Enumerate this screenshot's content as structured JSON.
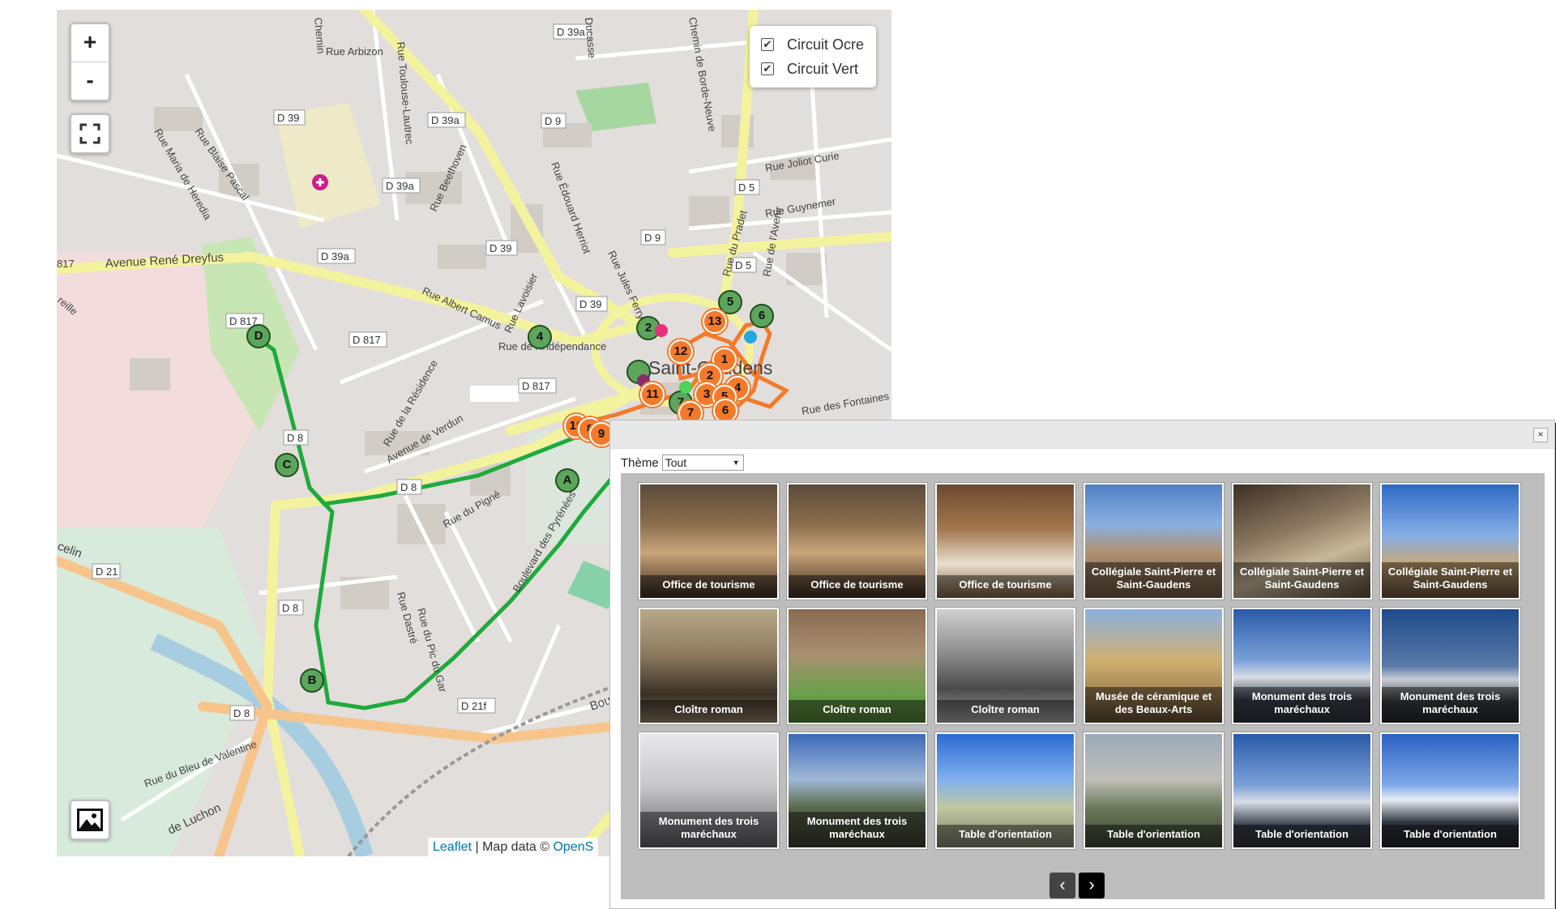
{
  "map": {
    "zoom_in": "+",
    "zoom_out": "-",
    "layers": [
      {
        "label": "Circuit Ocre",
        "checked": true
      },
      {
        "label": "Circuit Vert",
        "checked": true
      }
    ],
    "attribution": {
      "leaflet": "Leaflet",
      "sep": " | Map data © ",
      "osm": "OpenS"
    },
    "city_label": "Saint-Gaudens",
    "road_labels": [
      "D 39a",
      "D 39",
      "D 39a",
      "D 39a",
      "D 39a",
      "D 9",
      "D 9",
      "D 5",
      "D 5",
      "D 39",
      "D 39",
      "D 817",
      "D 817",
      "D 817",
      "D 8",
      "D 8",
      "D 8",
      "D 8",
      "D 21",
      "D 21f",
      "Avenue René Dreyfus",
      "Rue Arbizon",
      "Rue Toulouse-Lautrec",
      "Rue Blaise Pascal",
      "Rue Maria de Heredia",
      "Rue Beethoven",
      "Rue Édouard Herriot",
      "Rue Jules Ferry",
      "Rue Albert Camus",
      "Rue Lavoisier",
      "Rue de l'Indépendance",
      "Rue de la Résidence",
      "Avenue de Verdun",
      "Rue du Pigné",
      "Boulevard des Pyrénées",
      "Rue Joliot Curie",
      "Rue Guynemer",
      "Rue du Pradet",
      "Rue de l'Avenir",
      "Rue des Fontaines",
      "Rue Dastré",
      "Rue du Pic du Gar",
      "Boulevard",
      "de Luchon",
      "Rue du Bleu de Valentine",
      "Chemin de Borde-Neuve",
      "Ducasse",
      "Chemin",
      "celin",
      "817",
      "reille"
    ],
    "green_markers": [
      "D",
      "C",
      "B",
      "A",
      "4",
      "2",
      "5",
      "6",
      "7"
    ],
    "orange_markers": [
      "13",
      "12",
      "1",
      "2",
      "3",
      "4",
      "5",
      "6",
      "7",
      "11",
      "10",
      "8",
      "9"
    ]
  },
  "popup": {
    "close": "×",
    "theme_label": "Thème",
    "theme_value": "Tout",
    "tiles": [
      {
        "caption": "Office de tourisme",
        "scene": "shop"
      },
      {
        "caption": "Office de tourisme",
        "scene": "shop"
      },
      {
        "caption": "Office de tourisme",
        "scene": "ceramic"
      },
      {
        "caption": "Collégiale Saint-Pierre et Saint-Gaudens",
        "scene": "church"
      },
      {
        "caption": "Collégiale Saint-Pierre et Saint-Gaudens",
        "scene": "arch"
      },
      {
        "caption": "Collégiale Saint-Pierre et Saint-Gaudens",
        "scene": "church2"
      },
      {
        "caption": "Cloître roman",
        "scene": "cloister"
      },
      {
        "caption": "Cloître roman",
        "scene": "cloister2"
      },
      {
        "caption": "Cloître roman",
        "scene": "sculpture"
      },
      {
        "caption": "Musée de céramique et des Beaux-Arts",
        "scene": "museum"
      },
      {
        "caption": "Monument des trois maréchaux",
        "scene": "mountain"
      },
      {
        "caption": "Monument des trois maréchaux",
        "scene": "mountain2"
      },
      {
        "caption": "Monument des trois maréchaux",
        "scene": "statue"
      },
      {
        "caption": "Monument des trois maréchaux",
        "scene": "town"
      },
      {
        "caption": "Table d'orientation",
        "scene": "fountain"
      },
      {
        "caption": "Table d'orientation",
        "scene": "terrace"
      },
      {
        "caption": "Table d'orientation",
        "scene": "mountain"
      },
      {
        "caption": "Table d'orientation",
        "scene": "snowpeaks"
      }
    ],
    "prev": "‹",
    "next": "›"
  },
  "colors": {
    "ocre": "#f37a2a",
    "vert": "#1faa3c",
    "road_major": "#f7f6b0",
    "road_orange": "#f8c888"
  }
}
